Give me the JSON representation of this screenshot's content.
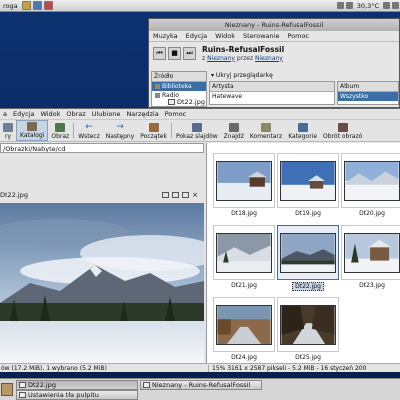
{
  "top_panel": {
    "menu": "roga",
    "clock": "30,3°C"
  },
  "music_window": {
    "title": "Nieznany - Ruins-RefusalFossil",
    "menu": [
      "Muzyka",
      "Edycja",
      "Widok",
      "Sterowanie",
      "Pomoc"
    ],
    "controls": {
      "prev": "⏮",
      "stop": "■",
      "next": "⏭"
    },
    "track": {
      "title": "Ruins-RefusalFossil",
      "prefix": "z",
      "album": "Nieznany",
      "by": "przez",
      "artist": "Nieznany"
    },
    "source": {
      "header": "Źródło",
      "items": [
        "Biblioteka",
        "Radio"
      ]
    },
    "browser_label": "Ukryj przeglądarkę",
    "artists": {
      "header": "Artysta",
      "items": [
        "Hatewave"
      ]
    },
    "albums": {
      "header": "Album",
      "items": [
        "Wszystko"
      ]
    },
    "file": "Dt22.jpg"
  },
  "viewer_window": {
    "menu": [
      "a",
      "Edycja",
      "Widok",
      "Obraz",
      "Ulubione",
      "Narzędzia",
      "Pomoc"
    ],
    "toolbar": [
      {
        "label": "ry",
        "icon": "folder-icon",
        "color": "#6a7f9a"
      },
      {
        "label": "Katalogi",
        "icon": "folders-icon",
        "color": "#7f6a4a"
      },
      {
        "label": "Obraz",
        "icon": "image-icon",
        "color": "#4a7a4a"
      },
      {
        "label": "Wstecz",
        "icon": "back-arrow-icon",
        "glyph": "←"
      },
      {
        "label": "Następny",
        "icon": "next-arrow-icon",
        "glyph": "→"
      },
      {
        "label": "Początek",
        "icon": "home-icon",
        "color": "#9a6a3a"
      },
      {
        "label": "Pokaz slajdów",
        "icon": "slideshow-icon",
        "color": "#5a6a8a"
      },
      {
        "label": "Znajdź",
        "icon": "find-icon",
        "color": "#6a6a6a"
      },
      {
        "label": "Komentarz",
        "icon": "comment-icon",
        "color": "#8a8a6a"
      },
      {
        "label": "Kategorie",
        "icon": "categories-icon",
        "color": "#4a6a9a"
      },
      {
        "label": "Obrót obrazó",
        "icon": "rotate-icon",
        "color": "#6a4a4a"
      }
    ],
    "path": "/Obrazki/Nabyte/cd",
    "preview_file": "Dt22.jpg",
    "thumbnails": [
      {
        "name": "Dt18.jpg",
        "selected": false
      },
      {
        "name": "Dt19.jpg",
        "selected": false
      },
      {
        "name": "Dt20.jpg",
        "selected": false
      },
      {
        "name": "Dt21.jpg",
        "selected": false
      },
      {
        "name": "Dt22.jpg",
        "selected": true
      },
      {
        "name": "Dt23.jpg",
        "selected": false
      },
      {
        "name": "Dt24.jpg",
        "selected": false
      },
      {
        "name": "Dt25.jpg",
        "selected": false
      }
    ],
    "status_left": "ów (17.2 MiB), 1 wybrano (5.2 MiB)",
    "status_right": "15%  3161 x 2587 pikseli - 5.2 MiB - 16 styczeń 200"
  },
  "taskbar": {
    "tasks": [
      {
        "label": "Dt22.jpg",
        "active": true
      },
      {
        "label": "Nieznany - Ruins-RefusalFossil",
        "active": false
      },
      {
        "label": "Ustawienia tła pulpitu",
        "active": false
      }
    ]
  }
}
